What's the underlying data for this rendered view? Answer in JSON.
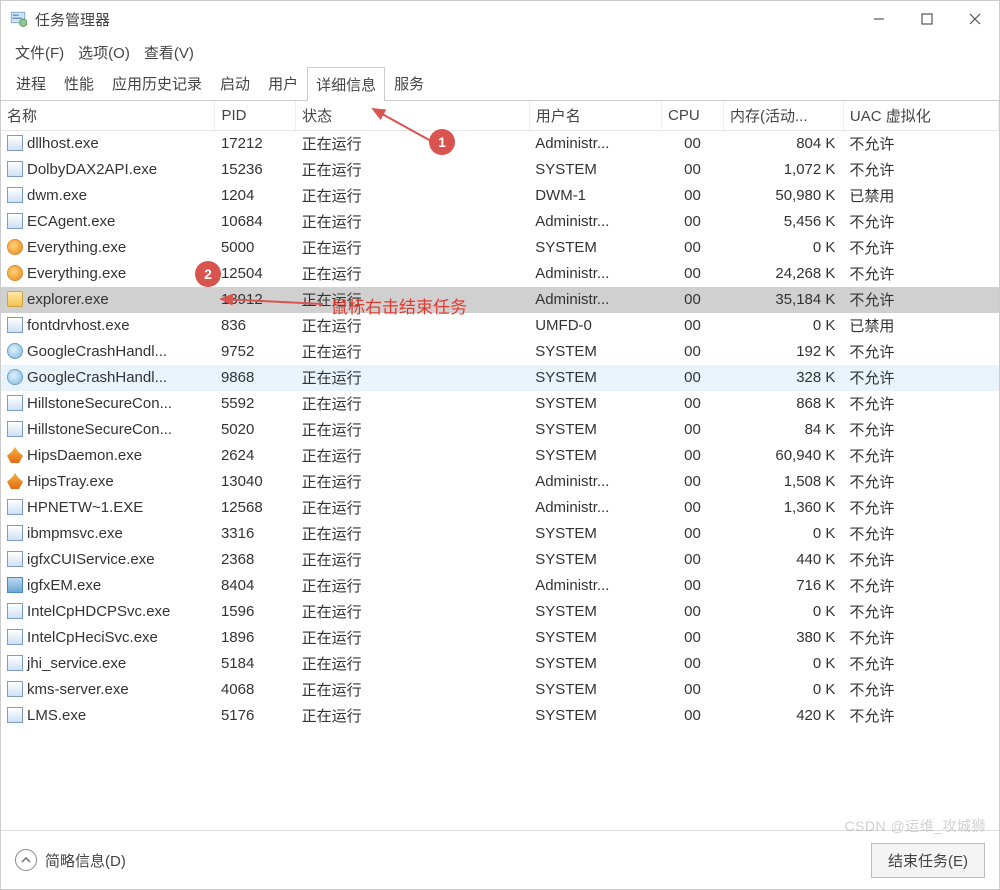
{
  "window": {
    "title": "任务管理器"
  },
  "menubar": [
    "文件(F)",
    "选项(O)",
    "查看(V)"
  ],
  "tabs": [
    "进程",
    "性能",
    "应用历史记录",
    "启动",
    "用户",
    "详细信息",
    "服务"
  ],
  "active_tab": 5,
  "columns": [
    "名称",
    "PID",
    "状态",
    "用户名",
    "CPU",
    "内存(活动...",
    "UAC 虚拟化"
  ],
  "processes": [
    {
      "icon": "default",
      "name": "dllhost.exe",
      "pid": "17212",
      "status": "正在运行",
      "user": "Administr...",
      "cpu": "00",
      "mem": "804 K",
      "uac": "不允许"
    },
    {
      "icon": "default",
      "name": "DolbyDAX2API.exe",
      "pid": "15236",
      "status": "正在运行",
      "user": "SYSTEM",
      "cpu": "00",
      "mem": "1,072 K",
      "uac": "不允许"
    },
    {
      "icon": "default",
      "name": "dwm.exe",
      "pid": "1204",
      "status": "正在运行",
      "user": "DWM-1",
      "cpu": "00",
      "mem": "50,980 K",
      "uac": "已禁用"
    },
    {
      "icon": "default",
      "name": "ECAgent.exe",
      "pid": "10684",
      "status": "正在运行",
      "user": "Administr...",
      "cpu": "00",
      "mem": "5,456 K",
      "uac": "不允许"
    },
    {
      "icon": "orange",
      "name": "Everything.exe",
      "pid": "5000",
      "status": "正在运行",
      "user": "SYSTEM",
      "cpu": "00",
      "mem": "0 K",
      "uac": "不允许"
    },
    {
      "icon": "orange",
      "name": "Everything.exe",
      "pid": "12504",
      "status": "正在运行",
      "user": "Administr...",
      "cpu": "00",
      "mem": "24,268 K",
      "uac": "不允许"
    },
    {
      "icon": "folder",
      "name": "explorer.exe",
      "pid": "18912",
      "status": "正在运行",
      "user": "Administr...",
      "cpu": "00",
      "mem": "35,184 K",
      "uac": "不允许",
      "selected": true
    },
    {
      "icon": "default",
      "name": "fontdrvhost.exe",
      "pid": "836",
      "status": "正在运行",
      "user": "UMFD-0",
      "cpu": "00",
      "mem": "0 K",
      "uac": "已禁用"
    },
    {
      "icon": "globe",
      "name": "GoogleCrashHandl...",
      "pid": "9752",
      "status": "正在运行",
      "user": "SYSTEM",
      "cpu": "00",
      "mem": "192 K",
      "uac": "不允许"
    },
    {
      "icon": "globe",
      "name": "GoogleCrashHandl...",
      "pid": "9868",
      "status": "正在运行",
      "user": "SYSTEM",
      "cpu": "00",
      "mem": "328 K",
      "uac": "不允许",
      "highlight": true
    },
    {
      "icon": "default",
      "name": "HillstoneSecureCon...",
      "pid": "5592",
      "status": "正在运行",
      "user": "SYSTEM",
      "cpu": "00",
      "mem": "868 K",
      "uac": "不允许"
    },
    {
      "icon": "default",
      "name": "HillstoneSecureCon...",
      "pid": "5020",
      "status": "正在运行",
      "user": "SYSTEM",
      "cpu": "00",
      "mem": "84 K",
      "uac": "不允许"
    },
    {
      "icon": "flame",
      "name": "HipsDaemon.exe",
      "pid": "2624",
      "status": "正在运行",
      "user": "SYSTEM",
      "cpu": "00",
      "mem": "60,940 K",
      "uac": "不允许"
    },
    {
      "icon": "flame",
      "name": "HipsTray.exe",
      "pid": "13040",
      "status": "正在运行",
      "user": "Administr...",
      "cpu": "00",
      "mem": "1,508 K",
      "uac": "不允许"
    },
    {
      "icon": "default",
      "name": "HPNETW~1.EXE",
      "pid": "12568",
      "status": "正在运行",
      "user": "Administr...",
      "cpu": "00",
      "mem": "1,360 K",
      "uac": "不允许"
    },
    {
      "icon": "default",
      "name": "ibmpmsvc.exe",
      "pid": "3316",
      "status": "正在运行",
      "user": "SYSTEM",
      "cpu": "00",
      "mem": "0 K",
      "uac": "不允许"
    },
    {
      "icon": "default",
      "name": "igfxCUIService.exe",
      "pid": "2368",
      "status": "正在运行",
      "user": "SYSTEM",
      "cpu": "00",
      "mem": "440 K",
      "uac": "不允许"
    },
    {
      "icon": "chip",
      "name": "igfxEM.exe",
      "pid": "8404",
      "status": "正在运行",
      "user": "Administr...",
      "cpu": "00",
      "mem": "716 K",
      "uac": "不允许"
    },
    {
      "icon": "default",
      "name": "IntelCpHDCPSvc.exe",
      "pid": "1596",
      "status": "正在运行",
      "user": "SYSTEM",
      "cpu": "00",
      "mem": "0 K",
      "uac": "不允许"
    },
    {
      "icon": "default",
      "name": "IntelCpHeciSvc.exe",
      "pid": "1896",
      "status": "正在运行",
      "user": "SYSTEM",
      "cpu": "00",
      "mem": "380 K",
      "uac": "不允许"
    },
    {
      "icon": "default",
      "name": "jhi_service.exe",
      "pid": "5184",
      "status": "正在运行",
      "user": "SYSTEM",
      "cpu": "00",
      "mem": "0 K",
      "uac": "不允许"
    },
    {
      "icon": "default",
      "name": "kms-server.exe",
      "pid": "4068",
      "status": "正在运行",
      "user": "SYSTEM",
      "cpu": "00",
      "mem": "0 K",
      "uac": "不允许"
    },
    {
      "icon": "default",
      "name": "LMS.exe",
      "pid": "5176",
      "status": "正在运行",
      "user": "SYSTEM",
      "cpu": "00",
      "mem": "420 K",
      "uac": "不允许"
    }
  ],
  "footer": {
    "fewer": "简略信息(D)",
    "end_task": "结束任务(E)"
  },
  "annotations": {
    "badge1": "1",
    "badge2": "2",
    "text": "鼠标右击结束任务"
  },
  "watermark": "CSDN @运维_攻城狮"
}
